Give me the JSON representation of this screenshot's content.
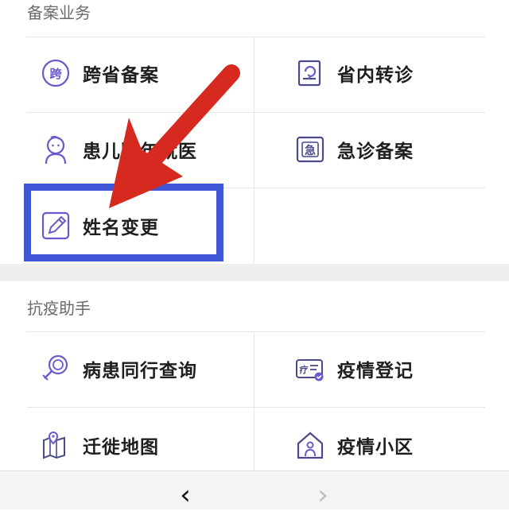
{
  "sections": [
    {
      "title": "备案业务",
      "items": [
        {
          "label": "跨省备案",
          "icon": "kua-badge-icon",
          "icon_text": "跨"
        },
        {
          "label": "省内转诊",
          "icon": "document-refresh-icon"
        },
        {
          "label": "患儿跨年就医",
          "icon": "child-face-icon"
        },
        {
          "label": "急诊备案",
          "icon": "emergency-doc-icon",
          "icon_text": "急"
        },
        {
          "label": "姓名变更",
          "icon": "pencil-edit-icon"
        }
      ]
    },
    {
      "title": "抗疫助手",
      "items": [
        {
          "label": "病患同行查询",
          "icon": "magnifier-person-icon"
        },
        {
          "label": "疫情登记",
          "icon": "epidemic-card-icon",
          "icon_text": "疗"
        },
        {
          "label": "迁徙地图",
          "icon": "map-pin-icon"
        },
        {
          "label": "疫情小区",
          "icon": "house-person-icon"
        }
      ]
    }
  ],
  "bottom_nav": {
    "back": "‹",
    "forward": "›"
  },
  "colors": {
    "icon_accent": "#6a5acd",
    "highlight_box": "#3f56d6",
    "arrow": "#d62a20"
  }
}
